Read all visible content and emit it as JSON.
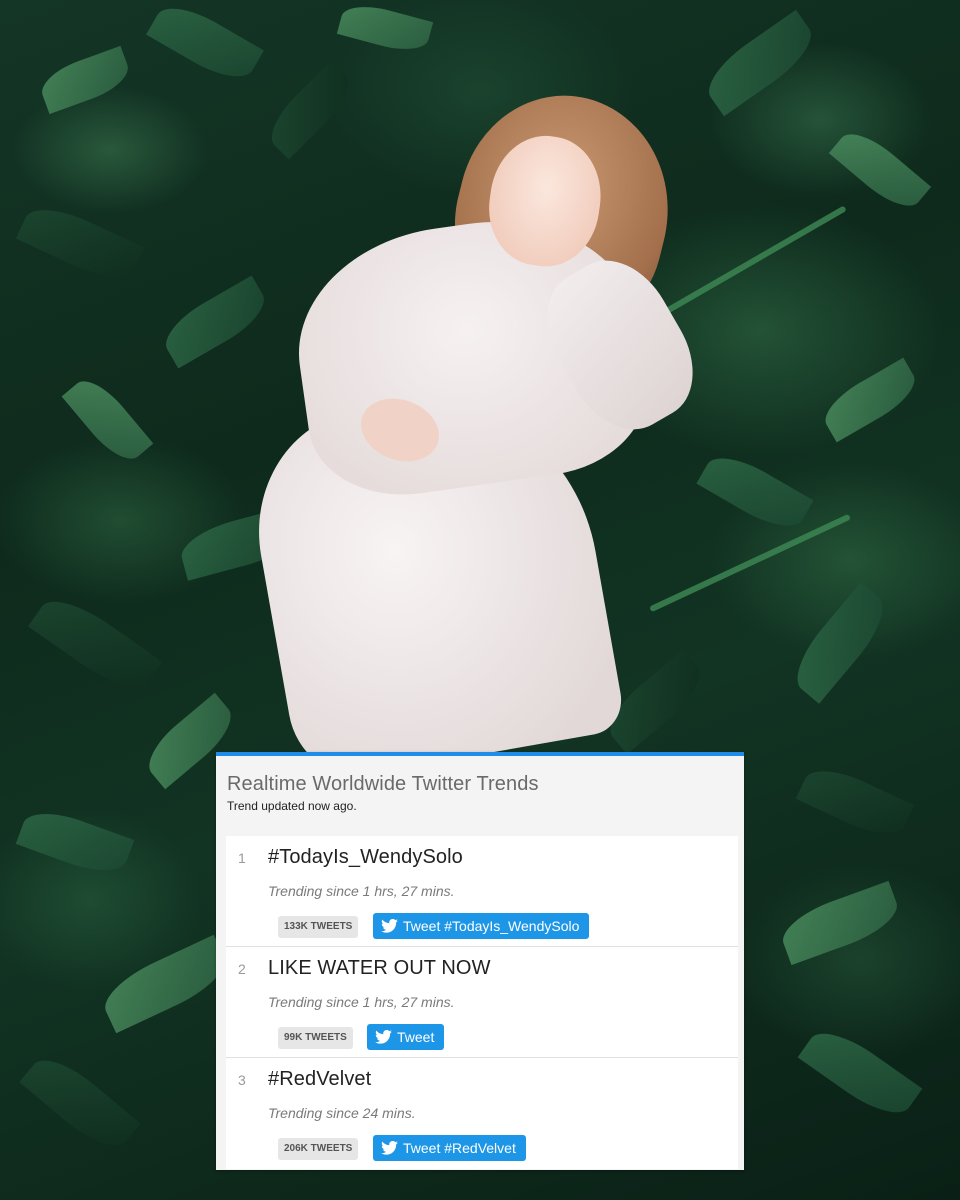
{
  "card": {
    "title": "Realtime Worldwide Twitter Trends",
    "subtitle": "Trend updated now ago.",
    "accent_color": "#1f8ce8",
    "button_color": "#1d96e8"
  },
  "trends": [
    {
      "rank": "1",
      "name": "#TodayIs_WendySolo",
      "since": "Trending since 1 hrs, 27 mins.",
      "tweet_count": "133K TWEETS",
      "button_label": "Tweet #TodayIs_WendySolo"
    },
    {
      "rank": "2",
      "name": "LIKE WATER OUT NOW",
      "since": "Trending since 1 hrs, 27 mins.",
      "tweet_count": "99K TWEETS",
      "button_label": "Tweet"
    },
    {
      "rank": "3",
      "name": "#RedVelvet",
      "since": "Trending since 24 mins.",
      "tweet_count": "206K TWEETS",
      "button_label": "Tweet #RedVelvet"
    }
  ],
  "icons": {
    "button_icon": "twitter-bird-icon"
  }
}
